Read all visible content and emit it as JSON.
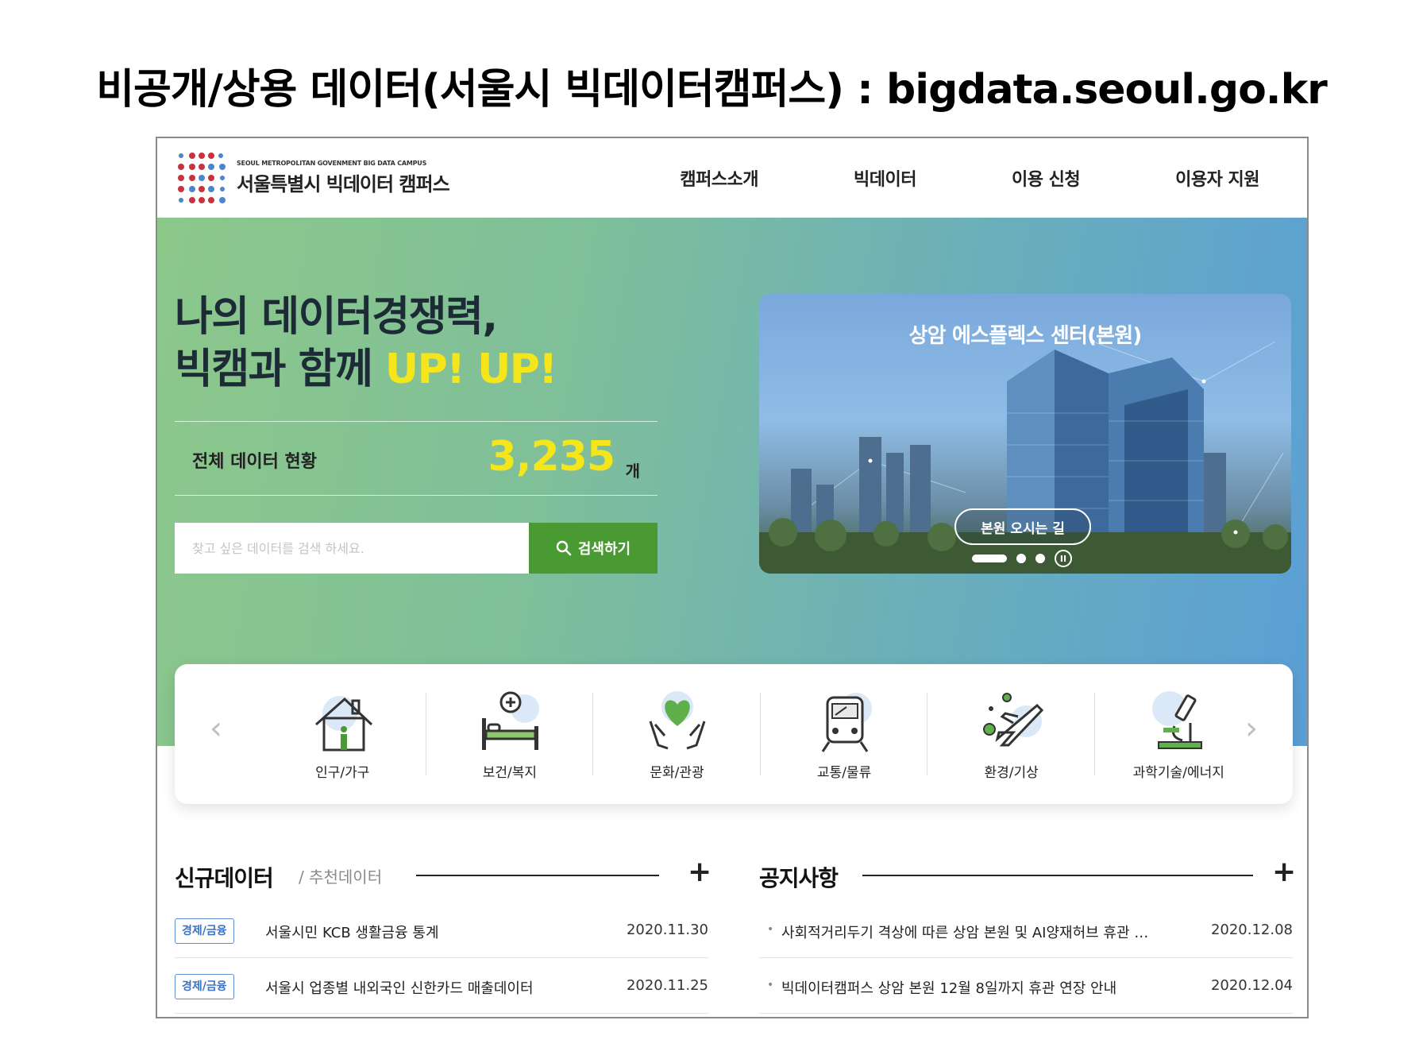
{
  "slide_title": "비공개/상용 데이터(서울시 빅데이터캠퍼스) : bigdata.seoul.go.kr",
  "header": {
    "logo_small": "SEOUL METROPOLITAN GOVENMENT BIG DATA CAMPUS",
    "logo_big": "서울특별시 빅데이터 캠퍼스",
    "nav": [
      "캠퍼스소개",
      "빅데이터",
      "이용 신청",
      "이용자 지원"
    ]
  },
  "hero": {
    "line1": "나의 데이터경쟁력,",
    "line2_prefix": "빅캠과 함께 ",
    "line2_highlight": "UP! UP!",
    "stat_label": "전체 데이터 현황",
    "stat_value": "3,235",
    "stat_unit": "개",
    "search_placeholder": "찾고 싶은 데이터를 검색 하세요.",
    "search_button": "검색하기"
  },
  "promo": {
    "title": "상암 에스플렉스 센터(본원)",
    "link": "본원 오시는 길"
  },
  "categories": [
    {
      "label": "인구/가구",
      "icon": "house-icon"
    },
    {
      "label": "보건/복지",
      "icon": "hospital-bed-icon"
    },
    {
      "label": "문화/관광",
      "icon": "heart-hands-icon"
    },
    {
      "label": "교통/물류",
      "icon": "train-icon"
    },
    {
      "label": "환경/기상",
      "icon": "airplane-weather-icon"
    },
    {
      "label": "과학기술/에너지",
      "icon": "microscope-icon"
    }
  ],
  "new_data": {
    "title": "신규데이터",
    "sub": "/ 추천데이터",
    "rows": [
      {
        "tag": "경제/금융",
        "title": "서울시민 KCB 생활금융 통계",
        "date": "2020.11.30"
      },
      {
        "tag": "경제/금융",
        "title": "서울시 업종별 내외국인 신한카드 매출데이터",
        "date": "2020.11.25"
      }
    ]
  },
  "notices": {
    "title": "공지사항",
    "rows": [
      {
        "title": "사회적거리두기 격상에 따른 상암 본원 및 AI양재허브 휴관 …",
        "date": "2020.12.08"
      },
      {
        "title": "빅데이터캠퍼스 상암 본원 12월 8일까지 휴관 연장 안내",
        "date": "2020.12.04"
      }
    ]
  },
  "colors": {
    "search_button": "#4a9a34",
    "highlight": "#f5e51b",
    "tag_border": "#5b8fd0",
    "logo_red": "#c8323c",
    "logo_blue": "#4a86d0"
  }
}
